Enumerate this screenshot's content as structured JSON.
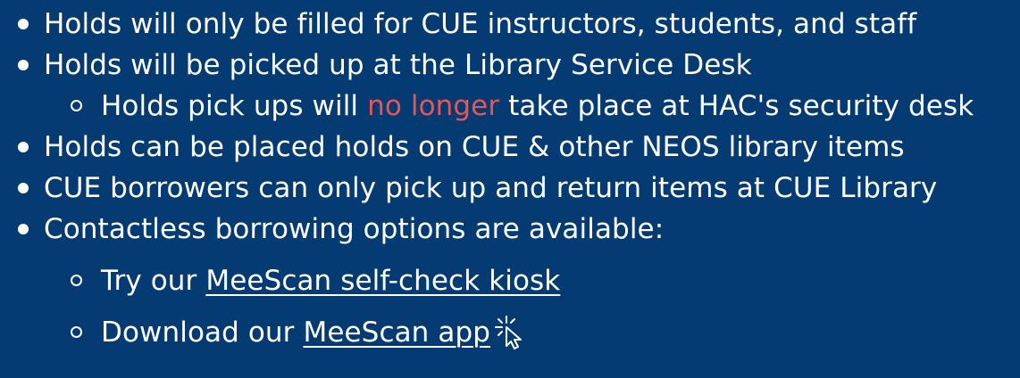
{
  "colors": {
    "background": "#043b72",
    "text": "#ffffff",
    "highlight": "#ea5454"
  },
  "items": [
    {
      "level": 1,
      "text": "Holds will only be filled for CUE instructors, students, and staff"
    },
    {
      "level": 1,
      "text": "Holds will be picked up at the Library Service Desk"
    },
    {
      "level": 2,
      "before": "Holds pick ups will ",
      "highlight": "no longer",
      "after": " take place at HAC's security desk"
    },
    {
      "level": 1,
      "text": "Holds can be placed holds on CUE & other NEOS library items"
    },
    {
      "level": 1,
      "text": "CUE borrowers can only pick up and return items at CUE Library"
    },
    {
      "level": 1,
      "text": "Contactless borrowing options are available:"
    },
    {
      "level": 2,
      "before": "Try our ",
      "link": "MeeScan self-check kiosk"
    },
    {
      "level": 2,
      "before": "Download our ",
      "link": "MeeScan app",
      "icon": "click-cursor-icon"
    }
  ]
}
